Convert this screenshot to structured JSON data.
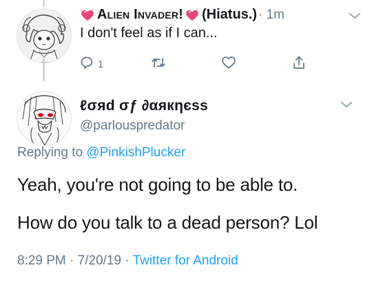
{
  "reply": {
    "display_name": "Alien Invader!",
    "display_name_suffix": "(Hiatus.)",
    "time": "· 1m",
    "text": "I don't feel as if I can...",
    "reply_count": "1",
    "icons": [
      "heart-emoji",
      "chevron-down-icon",
      "reply-icon",
      "retweet-icon",
      "like-icon",
      "share-icon"
    ]
  },
  "tweet": {
    "display_name": "ℓσяd σƒ ∂αякηєѕѕ",
    "handle": "@parlouspredator",
    "replying_prefix": "Replying to",
    "replying_handle": "@PinkishPlucker",
    "line1": "Yeah, you're not going to be able to.",
    "line2": "How do you talk to a dead person? Lol",
    "time": "8:29 PM",
    "date": "7/20/19",
    "source": "Twitter for Android"
  },
  "colors": {
    "accent": "#1da1f2",
    "muted": "#657786",
    "heart": "#e8457f"
  }
}
